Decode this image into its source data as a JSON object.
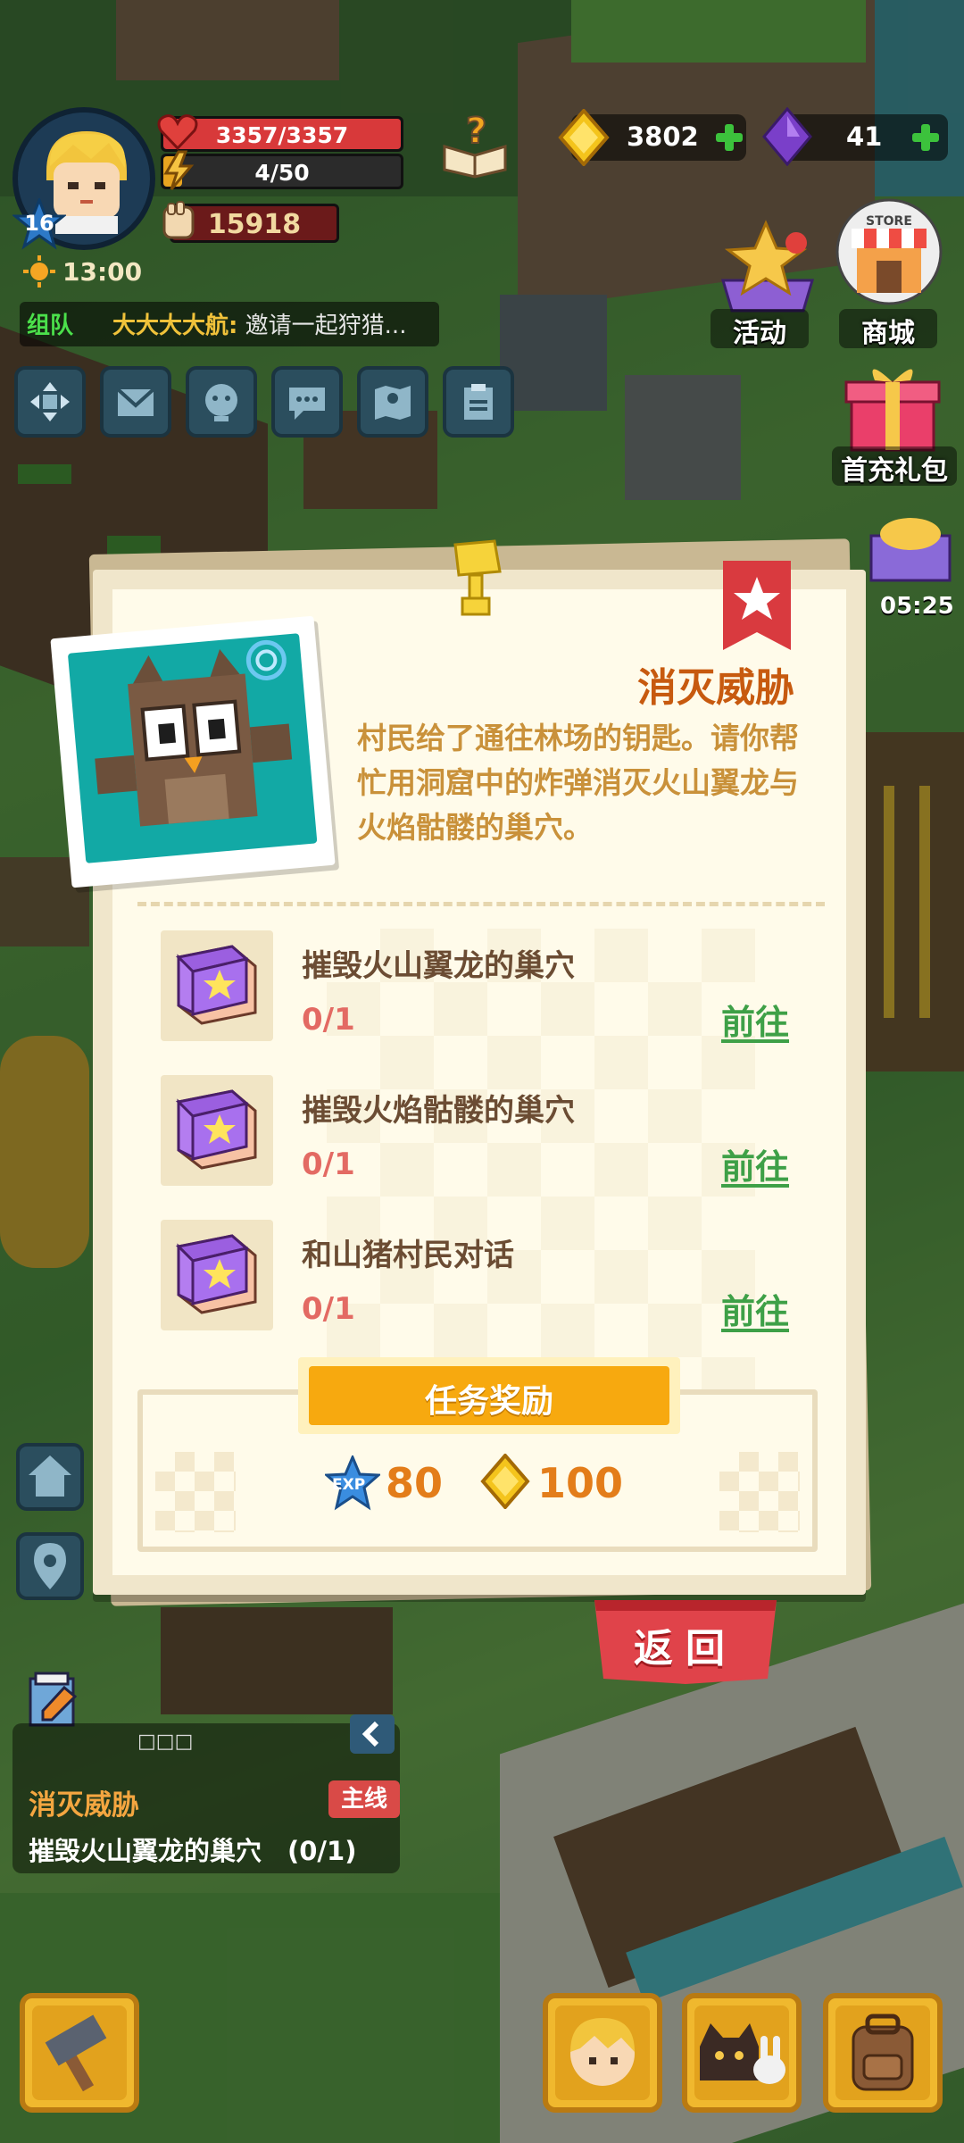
{
  "hud": {
    "level": "16",
    "hp_text": "3357/3357",
    "hp_fraction": 1.0,
    "energy_text": "4/50",
    "energy_fraction": 0.08,
    "power": "15918",
    "time": "13:00",
    "gold": "3802",
    "gems": "41"
  },
  "team_chat": {
    "tag": "组队",
    "sender": "大大大大航:",
    "message": " 邀请一起狩猎..."
  },
  "right_buttons": {
    "activity": "活动",
    "shop": "商城",
    "store_sign": "STORE",
    "first_recharge": "首充礼包",
    "timer": "05:25"
  },
  "quest": {
    "title": "消灭威胁",
    "description": "村民给了通往林场的钥匙。请你帮忙用洞窟中的炸弹消灭火山翼龙与火焰骷髅的巢穴。",
    "tasks": [
      {
        "name": "摧毁火山翼龙的巢穴",
        "progress": "0/1",
        "action": "前往"
      },
      {
        "name": "摧毁火焰骷髅的巢穴",
        "progress": "0/1",
        "action": "前往"
      },
      {
        "name": "和山猪村民对话",
        "progress": "0/1",
        "action": "前往"
      }
    ],
    "reward_header": "任务奖励",
    "rewards": {
      "exp_label": "EXP",
      "exp": "80",
      "gold": "100"
    },
    "back_label": "返回"
  },
  "tracker": {
    "dots": "□□□",
    "title": "消灭威胁",
    "tag": "主线",
    "task": "摧毁火山翼龙的巢穴　(0/1)"
  },
  "colors": {
    "title": "#c75a0f",
    "description": "#c9913a",
    "progress": "#e36a63",
    "go_link": "#3ea047",
    "reward_button": "#f7a90f",
    "back_button": "#e0434a"
  }
}
